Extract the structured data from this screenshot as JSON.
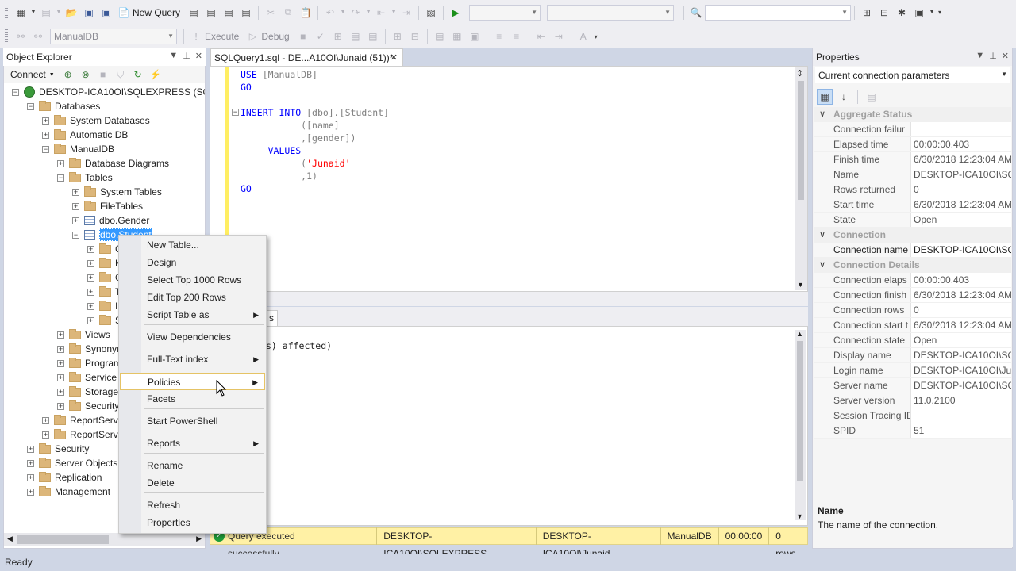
{
  "toolbar1": {
    "new_query": "New Query"
  },
  "toolbar2": {
    "database": "ManualDB",
    "execute": "Execute",
    "debug": "Debug"
  },
  "object_explorer": {
    "title": "Object Explorer",
    "connect": "Connect",
    "nodes": [
      {
        "label": "DESKTOP-ICA10OI\\SQLEXPRESS (SQL S",
        "level": 0,
        "expanded": true,
        "icon": "server-icon"
      },
      {
        "label": "Databases",
        "level": 1,
        "expanded": true,
        "icon": "folder-icon"
      },
      {
        "label": "System Databases",
        "level": 2,
        "expanded": false,
        "icon": "folder-icon"
      },
      {
        "label": "Automatic DB",
        "level": 2,
        "expanded": false,
        "icon": "folder-icon"
      },
      {
        "label": "ManualDB",
        "level": 2,
        "expanded": true,
        "icon": "folder-icon"
      },
      {
        "label": "Database Diagrams",
        "level": 3,
        "expanded": false,
        "icon": "folder-icon"
      },
      {
        "label": "Tables",
        "level": 3,
        "expanded": true,
        "icon": "folder-icon"
      },
      {
        "label": "System Tables",
        "level": 4,
        "expanded": false,
        "icon": "folder-icon"
      },
      {
        "label": "FileTables",
        "level": 4,
        "expanded": false,
        "icon": "folder-icon"
      },
      {
        "label": "dbo.Gender",
        "level": 4,
        "expanded": false,
        "icon": "table-icon"
      },
      {
        "label": "dbo.Student",
        "level": 4,
        "expanded": true,
        "icon": "table-icon",
        "selected": true
      },
      {
        "label": "C",
        "level": 5,
        "expanded": false,
        "icon": "folder-icon"
      },
      {
        "label": "K",
        "level": 5,
        "expanded": false,
        "icon": "folder-icon"
      },
      {
        "label": "C",
        "level": 5,
        "expanded": false,
        "icon": "folder-icon"
      },
      {
        "label": "T",
        "level": 5,
        "expanded": false,
        "icon": "folder-icon"
      },
      {
        "label": "I",
        "level": 5,
        "expanded": false,
        "icon": "folder-icon"
      },
      {
        "label": "S",
        "level": 5,
        "expanded": false,
        "icon": "folder-icon"
      },
      {
        "label": "Views",
        "level": 3,
        "expanded": false,
        "icon": "folder-icon"
      },
      {
        "label": "Synonyı",
        "level": 3,
        "expanded": false,
        "icon": "folder-icon"
      },
      {
        "label": "Program",
        "level": 3,
        "expanded": false,
        "icon": "folder-icon"
      },
      {
        "label": "Service",
        "level": 3,
        "expanded": false,
        "icon": "folder-icon"
      },
      {
        "label": "Storage",
        "level": 3,
        "expanded": false,
        "icon": "folder-icon"
      },
      {
        "label": "Security",
        "level": 3,
        "expanded": false,
        "icon": "folder-icon"
      },
      {
        "label": "ReportServe",
        "level": 2,
        "expanded": false,
        "icon": "folder-icon"
      },
      {
        "label": "ReportServe",
        "level": 2,
        "expanded": false,
        "icon": "folder-icon"
      },
      {
        "label": "Security",
        "level": 1,
        "expanded": false,
        "icon": "folder-icon"
      },
      {
        "label": "Server Objects",
        "level": 1,
        "expanded": false,
        "icon": "folder-icon"
      },
      {
        "label": "Replication",
        "level": 1,
        "expanded": false,
        "icon": "folder-icon"
      },
      {
        "label": "Management",
        "level": 1,
        "expanded": false,
        "icon": "folder-icon"
      }
    ]
  },
  "editor": {
    "tab_title": "SQLQuery1.sql - DE...A10OI\\Junaid (51))*",
    "results_tab": "s",
    "results_text": "s) affected)"
  },
  "context_menu": {
    "items": [
      {
        "label": "New Table...",
        "submenu": false
      },
      {
        "label": "Design",
        "submenu": false
      },
      {
        "label": "Select Top 1000 Rows",
        "submenu": false
      },
      {
        "label": "Edit Top 200 Rows",
        "submenu": false
      },
      {
        "label": "Script Table as",
        "submenu": true
      },
      {
        "label": "View Dependencies",
        "submenu": false
      },
      {
        "label": "Full-Text index",
        "submenu": true
      },
      {
        "label": "Policies",
        "submenu": true,
        "highlighted": true
      },
      {
        "label": "Facets",
        "submenu": false
      },
      {
        "label": "Start PowerShell",
        "submenu": false
      },
      {
        "label": "Reports",
        "submenu": true
      },
      {
        "label": "Rename",
        "submenu": false
      },
      {
        "label": "Delete",
        "submenu": false
      },
      {
        "label": "Refresh",
        "submenu": false
      },
      {
        "label": "Properties",
        "submenu": false
      }
    ]
  },
  "status_bar": {
    "message": "Query executed successfully.",
    "server": "DESKTOP-ICA10OI\\SQLEXPRESS ...",
    "user": "DESKTOP-ICA10OI\\Junaid...",
    "database": "ManualDB",
    "time": "00:00:00",
    "rows": "0 rows"
  },
  "properties": {
    "title": "Properties",
    "selector": "Current connection parameters",
    "rows": [
      {
        "cat": "Aggregate Status"
      },
      {
        "k": "Connection failur",
        "v": ""
      },
      {
        "k": "Elapsed time",
        "v": "00:00:00.403"
      },
      {
        "k": "Finish time",
        "v": "6/30/2018 12:23:04 AM"
      },
      {
        "k": "Name",
        "v": "DESKTOP-ICA10OI\\SQL"
      },
      {
        "k": "Rows returned",
        "v": "0"
      },
      {
        "k": "Start time",
        "v": "6/30/2018 12:23:04 AM"
      },
      {
        "k": "State",
        "v": "Open"
      },
      {
        "cat": "Connection"
      },
      {
        "k": "Connection name",
        "v": "DESKTOP-ICA10OI\\SQL",
        "dark": true
      },
      {
        "cat": "Connection Details"
      },
      {
        "k": "Connection elaps",
        "v": "00:00:00.403"
      },
      {
        "k": "Connection finish",
        "v": "6/30/2018 12:23:04 AM"
      },
      {
        "k": "Connection rows",
        "v": "0"
      },
      {
        "k": "Connection start t",
        "v": "6/30/2018 12:23:04 AM"
      },
      {
        "k": "Connection state",
        "v": "Open"
      },
      {
        "k": "Display name",
        "v": "DESKTOP-ICA10OI\\SQL"
      },
      {
        "k": "Login name",
        "v": "DESKTOP-ICA10OI\\Juna"
      },
      {
        "k": "Server name",
        "v": "DESKTOP-ICA10OI\\SQL"
      },
      {
        "k": "Server version",
        "v": "11.0.2100"
      },
      {
        "k": "Session Tracing ID",
        "v": ""
      },
      {
        "k": "SPID",
        "v": "51"
      }
    ],
    "desc_title": "Name",
    "desc_text": "The name of the connection."
  },
  "app_status": "Ready"
}
